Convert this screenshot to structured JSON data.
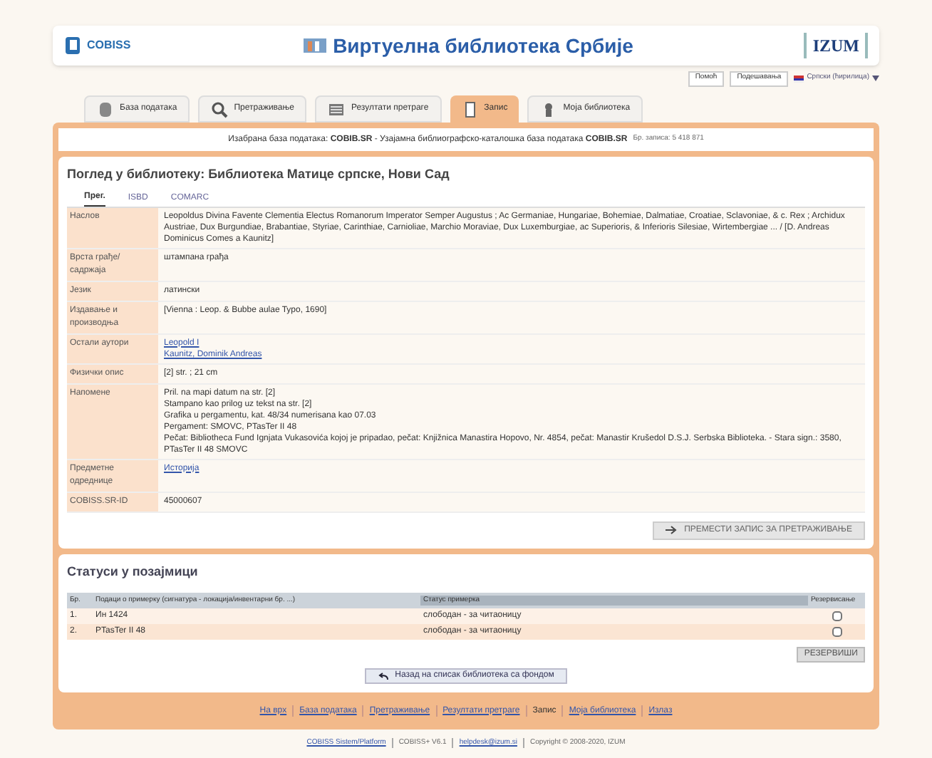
{
  "header": {
    "title": "Виртуелна библиотека Србије",
    "left_logo": "COBISS",
    "right_logo": "IZUM"
  },
  "top_buttons": [
    "Помоћ",
    "Подешавања"
  ],
  "language": "Српски (ћирилица)",
  "tabs": [
    {
      "label": "База података",
      "selected": false
    },
    {
      "label": "Претраживање",
      "selected": false
    },
    {
      "label": "Резултати претраге",
      "selected": false
    },
    {
      "label": "Запис",
      "selected": true
    },
    {
      "label": "Моја библиотека",
      "selected": false
    }
  ],
  "database_bar": {
    "text": "Изабрана база података: **COBIB.SR** - Узајамна библиографско-каталошка база података **COBIB.SR**",
    "note": "Бр. записа: 5 418 871"
  },
  "record": {
    "title": "Поглед у библиотеку: Библиотека Матице српске, Нови Сад",
    "view_tabs": [
      {
        "label": "Прег.",
        "selected": true
      },
      {
        "label": "ISBD",
        "selected": false
      },
      {
        "label": "COMARC",
        "selected": false
      }
    ],
    "fields": [
      {
        "label": "Наслов",
        "lines": [
          "Leopoldus Divina Favente Clementia Electus Romanorum Imperator Semper Augustus ; Ac Germaniae, Hungariae, Bohemiae, Dalmatiae, Croatiae, Sclavoniae, & c. Rex ; Archidux Austriae, Dux Burgundiae, Brabantiae, Styriae, Carinthiae, Carnioliae, Marchio Moraviae, Dux Luxemburgiae, ac Superioris, & Inferioris Silesiae, Wirtembergiae ... / [D. Andreas Dominicus Comes a Kaunitz]"
        ],
        "link": false
      },
      {
        "label": "Врста грађе/садржаја",
        "lines": [
          "штампана грађа"
        ],
        "link": false
      },
      {
        "label": "Језик",
        "lines": [
          "латински"
        ],
        "link": false
      },
      {
        "label": "Издавање и производња",
        "lines": [
          "[Vienna : Leop. & Bubbe aulae Typo, 1690]"
        ],
        "link": false
      },
      {
        "label": "Остали аутори",
        "lines": [
          "Leopold I",
          "Kaunitz, Dominik Andreas"
        ],
        "link": true
      },
      {
        "label": "Физички опис",
        "lines": [
          "[2] str. ; 21 cm"
        ],
        "link": false
      },
      {
        "label": "Напомене",
        "lines": [
          "Pril. na mapi datum na str. [2]",
          "Stampano kao prilog uz tekst na str. [2]",
          "Grafika u pergamentu, kat. 48/34 numerisana kao 07.03",
          "Pergament: SMOVC, PTasTer II 48",
          "Pečat: Bibliotheca Fund Ignjata Vukasovića kojoj je pripadao, pečat: Knjižnica Manastira Hopovo, Nr. 4854, pečat: Manastir Krušedol D.S.J. Serbska Biblioteka. - Stara sign.: 3580, PTasTer II 48 SMOVC"
        ],
        "link": false
      },
      {
        "label": "Предметне одреднице",
        "lines": [
          "Историја"
        ],
        "link": true
      },
      {
        "label": "COBISS.SR-ID",
        "lines": [
          "45000607"
        ],
        "link": false
      }
    ],
    "action_button": "ПРЕМЕСТИ ЗАПИС ЗА ПРЕТРАЖИВАЊЕ"
  },
  "holdings": {
    "title": "Статуси у позајмици",
    "columns": [
      "Бр.",
      "Подаци о примерку (сигнатура - локација/инвентарни бр. ...)",
      "Статус примерка",
      "Резервисање"
    ],
    "rows": [
      {
        "number": "1.",
        "item": "Ин 1424",
        "status": "слободан - за читаоницу",
        "checked": false
      },
      {
        "number": "2.",
        "item": "PTasTer II 48",
        "status": "слободан - за читаоницу",
        "checked": false
      }
    ],
    "reserve_button": "РЕЗЕРВИШИ",
    "back_button": "Назад на списак библиотека са фондом"
  },
  "footer_links": [
    {
      "label": "На врх",
      "current": false
    },
    {
      "label": "База података",
      "current": false
    },
    {
      "label": "Претраживање",
      "current": false
    },
    {
      "label": "Резултати претраге",
      "current": false
    },
    {
      "label": "Запис",
      "current": true
    },
    {
      "label": "Моја библиотека",
      "current": false
    },
    {
      "label": "Излаз",
      "current": false
    }
  ],
  "bottom_line": {
    "links": [
      "COBISS Sistem/Platform",
      "helpdesk@izum.si"
    ],
    "texts": [
      "COBISS+ V6.1",
      "Copyright © 2008-2020, IZUM"
    ]
  }
}
